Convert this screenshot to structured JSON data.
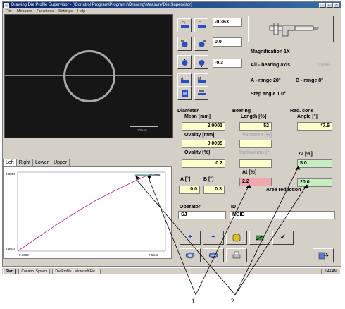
{
  "window": {
    "title": "Drawing Die Profile Supervisor - [\\Conatrol Program\\Programs\\Drawing\\Measure\\Die Supervisor]",
    "menu": [
      "File",
      "Measure",
      "Functions",
      "Settings",
      "Help"
    ],
    "controls": [
      "_",
      "□",
      "×"
    ]
  },
  "video": {
    "scale_label": "100um"
  },
  "toolbar": {
    "readouts": [
      "-0.363",
      "0.0",
      "-0.3"
    ],
    "icons": [
      "focus-plus-icon",
      "focus-minus-icon",
      "center-left-icon",
      "center-right-icon",
      "center-down-icon",
      "center-up-icon",
      "focus-auto-icon",
      "focus-manual-icon",
      "light-icon",
      "measure-icon"
    ]
  },
  "info": {
    "magnification": "Magnification 1X",
    "mode": "All - bearing axis",
    "mode_value": "100%",
    "a_range": "A - range 28°",
    "b_range": "B - range 8°",
    "step_angle": "Step angle 1.0°"
  },
  "diameter": {
    "header": "Diameter",
    "mean_label": "Mean [mm]",
    "mean_value": "2.0001",
    "ovality_mm_label": "Ovality [mm]",
    "ovality_mm_value": "0.0035",
    "ovality_pct_label": "Ovality [%]",
    "ovality_pct_value": "0.2"
  },
  "bearing": {
    "header": "Bearing",
    "length_label": "Length [%]",
    "length_value": "52",
    "variation_label": "Variation [%]",
    "variation_value": "",
    "inclination_label": "Inclination [°]",
    "inclination_value": "",
    "at_label": "At [%]",
    "at_value": "2.2"
  },
  "red_cone": {
    "header": "Red. cone",
    "angle_label": "Angle [°]",
    "angle_value": "*7.6",
    "ai_label": "AI [%]",
    "ai_value": "5.0",
    "reduction_value": "20.0",
    "reduction_label": "Area reduction"
  },
  "angles": {
    "a_label": "A [°]",
    "a_value": "0.0",
    "b_label": "B [°]",
    "b_value": "0.3"
  },
  "operator": {
    "label": "Operator",
    "value": "SJ"
  },
  "id": {
    "label": "ID",
    "value": "NOID"
  },
  "tabs": [
    "Left",
    "Right",
    "Lower",
    "Upper"
  ],
  "chart_data": {
    "type": "line",
    "y_top_label": "2.0803",
    "y_bottom_label": "2.5034",
    "x_left_label": "0.0000",
    "x_right_label": "7.6842",
    "series": [
      {
        "color": "#c0208a",
        "x": [
          0,
          1,
          2,
          3,
          4,
          5,
          6,
          6.6,
          7.0,
          7.4
        ],
        "y": [
          0,
          0.17,
          0.34,
          0.5,
          0.65,
          0.78,
          0.9,
          0.97,
          1.0,
          0.99
        ]
      },
      {
        "color": "#1a3fd0",
        "x": [
          6.1,
          7.4
        ],
        "y": [
          1.0,
          1.0
        ]
      },
      {
        "color": "#2a9a2a",
        "x": [
          6.1,
          7.4
        ],
        "y": [
          0.985,
          0.985
        ]
      }
    ]
  },
  "buttons": {
    "row1": [
      "+",
      "−",
      "database-icon",
      "erase-icon",
      "✓"
    ],
    "row2": [
      "save-icon",
      "copy-icon",
      "print-icon"
    ],
    "exit": "exit-icon"
  },
  "taskbar": {
    "start": "Start",
    "items": [
      "Conatrol System",
      "Die Profile - Microsoft Ext..."
    ],
    "clock": "5:44 AM"
  },
  "callouts": [
    "1.",
    "2."
  ]
}
